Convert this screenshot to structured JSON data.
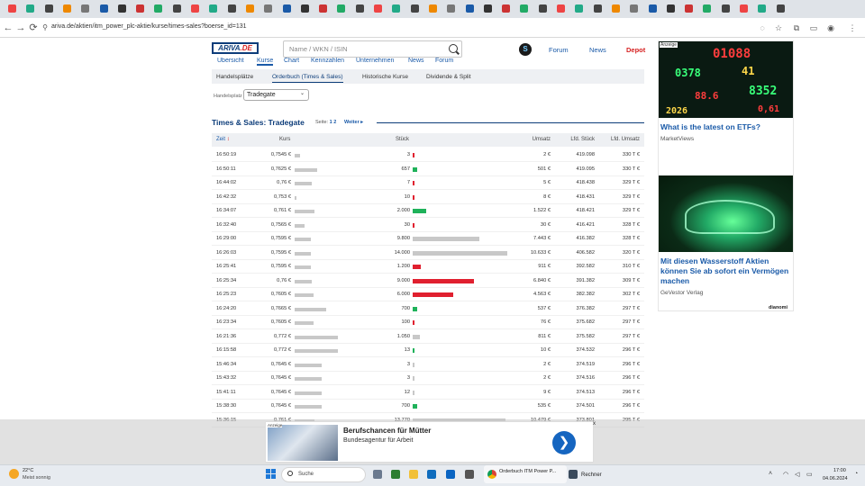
{
  "browser": {
    "url": "ariva.de/aktien/itm_power_plc-aktie/kurse/times-sales?boerse_id=131"
  },
  "header": {
    "logo": "ARIVA",
    "logo_suffix": ".DE",
    "search_placeholder": "Name / WKN / ISIN",
    "badge": "S",
    "nav": [
      "Forum",
      "News",
      "Depot"
    ]
  },
  "subtabs": [
    "Übersicht",
    "Kurse",
    "Chart",
    "Kennzahlen",
    "Unternehmen",
    "News",
    "Forum"
  ],
  "subnav2": [
    "Handelsplätze",
    "Orderbuch (Times & Sales)",
    "Historische Kurse",
    "Dividende & Split"
  ],
  "handelsplatz": {
    "label": "Handelsplatz",
    "selected": "Tradegate"
  },
  "section": {
    "title": "Times & Sales: Tradegate",
    "pages_label": "Seite:",
    "pages": "1 2",
    "next": "Weiter ▸"
  },
  "table": {
    "headers": {
      "zeit": "Zeit",
      "kurs": "Kurs",
      "stueck": "Stück",
      "umsatz": "Umsatz",
      "lfd_stueck": "Lfd. Stück",
      "lfd_umsatz": "Lfd. Umsatz"
    },
    "rows": [
      {
        "time": "16:50:19",
        "kurs": "0,7545 €",
        "kurs_val": 0.7545,
        "stueck": "3",
        "stueck_val": 3,
        "dir": "down",
        "umsatz": "2 €",
        "lfd": "419.098",
        "lfdu": "330 T €"
      },
      {
        "time": "16:50:11",
        "kurs": "0,7625 €",
        "kurs_val": 0.7625,
        "stueck": "657",
        "stueck_val": 657,
        "dir": "up",
        "umsatz": "501 €",
        "lfd": "419.095",
        "lfdu": "330 T €"
      },
      {
        "time": "16:44:02",
        "kurs": "0,76 €",
        "kurs_val": 0.76,
        "stueck": "7",
        "stueck_val": 7,
        "dir": "down",
        "umsatz": "5 €",
        "lfd": "418.438",
        "lfdu": "329 T €"
      },
      {
        "time": "16:42:32",
        "kurs": "0,753 €",
        "kurs_val": 0.753,
        "stueck": "10",
        "stueck_val": 10,
        "dir": "down",
        "umsatz": "8 €",
        "lfd": "418.431",
        "lfdu": "329 T €"
      },
      {
        "time": "16:34:07",
        "kurs": "0,761 €",
        "kurs_val": 0.761,
        "stueck": "2.000",
        "stueck_val": 2000,
        "dir": "up",
        "umsatz": "1.522 €",
        "lfd": "418.421",
        "lfdu": "329 T €"
      },
      {
        "time": "16:32:40",
        "kurs": "0,7565 €",
        "kurs_val": 0.7565,
        "stueck": "30",
        "stueck_val": 30,
        "dir": "down",
        "umsatz": "30 €",
        "lfd": "416.421",
        "lfdu": "328 T €"
      },
      {
        "time": "16:29:00",
        "kurs": "0,7595 €",
        "kurs_val": 0.7595,
        "stueck": "9.800",
        "stueck_val": 9800,
        "dir": "neutral",
        "umsatz": "7.443 €",
        "lfd": "416.382",
        "lfdu": "328 T €"
      },
      {
        "time": "16:26:03",
        "kurs": "0,7595 €",
        "kurs_val": 0.7595,
        "stueck": "14.000",
        "stueck_val": 14000,
        "dir": "neutral",
        "umsatz": "10.633 €",
        "lfd": "406.582",
        "lfdu": "320 T €"
      },
      {
        "time": "16:25:41",
        "kurs": "0,7595 €",
        "kurs_val": 0.7595,
        "stueck": "1.200",
        "stueck_val": 1200,
        "dir": "down",
        "umsatz": "911 €",
        "lfd": "392.582",
        "lfdu": "310 T €"
      },
      {
        "time": "16:25:34",
        "kurs": "0,76 €",
        "kurs_val": 0.76,
        "stueck": "9.000",
        "stueck_val": 9000,
        "dir": "down",
        "umsatz": "6.840 €",
        "lfd": "391.382",
        "lfdu": "309 T €"
      },
      {
        "time": "16:25:23",
        "kurs": "0,7605 €",
        "kurs_val": 0.7605,
        "stueck": "6.000",
        "stueck_val": 6000,
        "dir": "down",
        "umsatz": "4.563 €",
        "lfd": "382.382",
        "lfdu": "302 T €"
      },
      {
        "time": "16:24:20",
        "kurs": "0,7665 €",
        "kurs_val": 0.7665,
        "stueck": "700",
        "stueck_val": 700,
        "dir": "up",
        "umsatz": "537 €",
        "lfd": "376.382",
        "lfdu": "297 T €"
      },
      {
        "time": "16:23:34",
        "kurs": "0,7605 €",
        "kurs_val": 0.7605,
        "stueck": "100",
        "stueck_val": 100,
        "dir": "down",
        "umsatz": "76 €",
        "lfd": "375.682",
        "lfdu": "297 T €"
      },
      {
        "time": "16:21:36",
        "kurs": "0,772 €",
        "kurs_val": 0.772,
        "stueck": "1.050",
        "stueck_val": 1050,
        "dir": "neutral",
        "umsatz": "811 €",
        "lfd": "375.582",
        "lfdu": "297 T €"
      },
      {
        "time": "16:15:58",
        "kurs": "0,772 €",
        "kurs_val": 0.772,
        "stueck": "13",
        "stueck_val": 13,
        "dir": "up",
        "umsatz": "10 €",
        "lfd": "374.532",
        "lfdu": "296 T €"
      },
      {
        "time": "15:46:34",
        "kurs": "0,7645 €",
        "kurs_val": 0.7645,
        "stueck": "3",
        "stueck_val": 3,
        "dir": "neutral",
        "umsatz": "2 €",
        "lfd": "374.519",
        "lfdu": "296 T €"
      },
      {
        "time": "15:43:32",
        "kurs": "0,7645 €",
        "kurs_val": 0.7645,
        "stueck": "3",
        "stueck_val": 3,
        "dir": "neutral",
        "umsatz": "2 €",
        "lfd": "374.516",
        "lfdu": "296 T €"
      },
      {
        "time": "15:41:11",
        "kurs": "0,7645 €",
        "kurs_val": 0.7645,
        "stueck": "12",
        "stueck_val": 12,
        "dir": "neutral",
        "umsatz": "9 €",
        "lfd": "374.513",
        "lfdu": "296 T €"
      },
      {
        "time": "15:38:30",
        "kurs": "0,7645 €",
        "kurs_val": 0.7645,
        "stueck": "700",
        "stueck_val": 700,
        "dir": "up",
        "umsatz": "535 €",
        "lfd": "374.501",
        "lfdu": "296 T €"
      },
      {
        "time": "15:36:15",
        "kurs": "0,761 €",
        "kurs_val": 0.761,
        "stueck": "13.770",
        "stueck_val": 13770,
        "dir": "neutral",
        "umsatz": "10.479 €",
        "lfd": "373.801",
        "lfdu": "295 T €"
      }
    ]
  },
  "bottom_ad": {
    "tag": "Anzeige",
    "title": "Berufschancen für Mütter",
    "subtitle": "Bundesagentur für Arbeit",
    "go": "❯",
    "close": "x"
  },
  "side_ads": {
    "label": "Anzeige",
    "ad1": {
      "title": "What is the latest on ETFs?",
      "source": "MarketViews",
      "ticker": [
        "01088",
        "0378",
        "41",
        "88.6",
        "8352",
        "2026",
        "0,61"
      ]
    },
    "ad2": {
      "title": "Mit diesen Wasserstoff Aktien können Sie ab sofort ein Vermögen machen",
      "source": "GeVestor Verlag"
    },
    "brand": "dianomi"
  },
  "taskbar": {
    "temp": "22°C",
    "weather": "Meist sonnig",
    "search": "Suche",
    "chrome_label": "Orderbuch ITM Power P...",
    "rechner": "Rechner",
    "time": "17:00",
    "date": "04.06.2024"
  },
  "colors": {
    "up": "#1fb25a",
    "down": "#e0202f",
    "neutral": "#c8c8c8",
    "brand": "#0d3d7a",
    "link": "#1a5aa8"
  }
}
